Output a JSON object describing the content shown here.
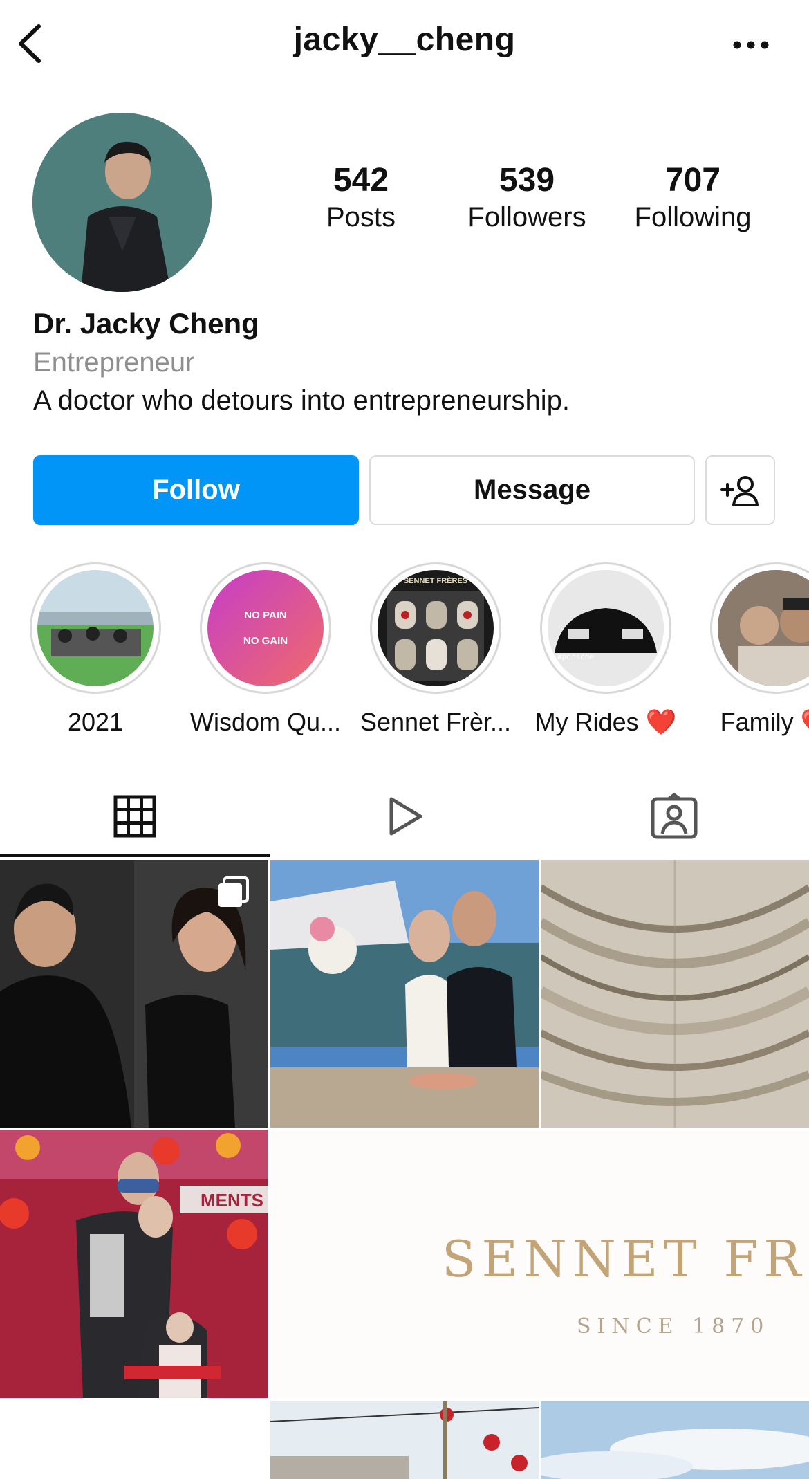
{
  "header": {
    "username": "jacky__cheng",
    "back_icon": "chevron-left-icon",
    "more_icon": "more-horizontal-icon"
  },
  "profile": {
    "name": "Dr. Jacky Cheng",
    "category": "Entrepreneur",
    "bio": "A doctor who detours into entrepreneurship."
  },
  "stats": [
    {
      "value": "542",
      "label": "Posts"
    },
    {
      "value": "539",
      "label": "Followers"
    },
    {
      "value": "707",
      "label": "Following"
    }
  ],
  "actions": {
    "follow": "Follow",
    "message": "Message",
    "add_user_icon": "add-user-icon"
  },
  "highlights": [
    {
      "label": "2021"
    },
    {
      "label": "Wisdom Qu...",
      "line1": "NO PAIN",
      "line2": "NO GAIN"
    },
    {
      "label": "Sennet Frèr...",
      "sign": "SENNET FRÈRES"
    },
    {
      "label": "My Rides",
      "emoji": "❤️",
      "tag": "#porsche"
    },
    {
      "label": "Family",
      "emoji": "❤️"
    }
  ],
  "tabs": [
    "grid-icon",
    "reels-icon",
    "tagged-icon"
  ],
  "posts": {
    "post5_brand": "SENNET FRÈ",
    "post5_since": "SINCE 1870",
    "post4_sign": "MENTS"
  },
  "colors": {
    "accent": "#0095f6",
    "border": "#dbdbdb",
    "secondary_text": "#8e8e8e"
  }
}
